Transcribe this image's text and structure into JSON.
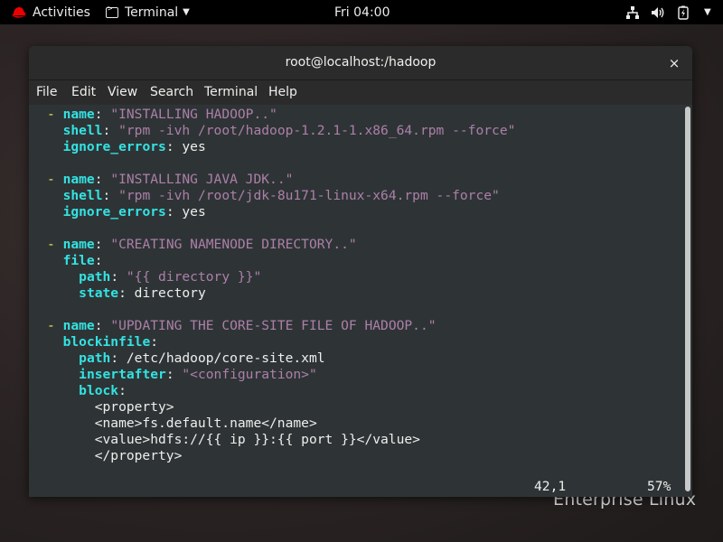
{
  "topbar": {
    "activities": "Activities",
    "app_name": "Terminal",
    "clock": "Fri 04:00"
  },
  "desktop": {
    "brand": "Enterprise Linux"
  },
  "window": {
    "title": "root@localhost:/hadoop",
    "close": "×"
  },
  "menu": [
    "File",
    "Edit",
    "View",
    "Search",
    "Terminal",
    "Help"
  ],
  "editor": {
    "lines": [
      [
        {
          "c": "d",
          "t": "- "
        },
        {
          "c": "k",
          "t": "name"
        },
        {
          "c": "",
          "t": ": "
        },
        {
          "c": "s",
          "t": "\"INSTALLING HADOOP..\""
        }
      ],
      [
        {
          "c": "",
          "t": "  "
        },
        {
          "c": "k",
          "t": "shell"
        },
        {
          "c": "",
          "t": ": "
        },
        {
          "c": "s",
          "t": "\"rpm -ivh /root/hadoop-1.2.1-1.x86_64.rpm --force\""
        }
      ],
      [
        {
          "c": "",
          "t": "  "
        },
        {
          "c": "k",
          "t": "ignore_errors"
        },
        {
          "c": "",
          "t": ": yes"
        }
      ],
      [],
      [
        {
          "c": "d",
          "t": "- "
        },
        {
          "c": "k",
          "t": "name"
        },
        {
          "c": "",
          "t": ": "
        },
        {
          "c": "s",
          "t": "\"INSTALLING JAVA JDK..\""
        }
      ],
      [
        {
          "c": "",
          "t": "  "
        },
        {
          "c": "k",
          "t": "shell"
        },
        {
          "c": "",
          "t": ": "
        },
        {
          "c": "s",
          "t": "\"rpm -ivh /root/jdk-8u171-linux-x64.rpm --force\""
        }
      ],
      [
        {
          "c": "",
          "t": "  "
        },
        {
          "c": "k",
          "t": "ignore_errors"
        },
        {
          "c": "",
          "t": ": yes"
        }
      ],
      [],
      [
        {
          "c": "d",
          "t": "- "
        },
        {
          "c": "k",
          "t": "name"
        },
        {
          "c": "",
          "t": ": "
        },
        {
          "c": "s",
          "t": "\"CREATING NAMENODE DIRECTORY..\""
        }
      ],
      [
        {
          "c": "",
          "t": "  "
        },
        {
          "c": "k",
          "t": "file"
        },
        {
          "c": "",
          "t": ":"
        }
      ],
      [
        {
          "c": "",
          "t": "    "
        },
        {
          "c": "k",
          "t": "path"
        },
        {
          "c": "",
          "t": ": "
        },
        {
          "c": "s",
          "t": "\"{{ directory }}\""
        }
      ],
      [
        {
          "c": "",
          "t": "    "
        },
        {
          "c": "k",
          "t": "state"
        },
        {
          "c": "",
          "t": ": directory"
        }
      ],
      [],
      [
        {
          "c": "d",
          "t": "- "
        },
        {
          "c": "k",
          "t": "name"
        },
        {
          "c": "",
          "t": ": "
        },
        {
          "c": "s",
          "t": "\"UPDATING THE CORE-SITE FILE OF HADOOP..\""
        }
      ],
      [
        {
          "c": "",
          "t": "  "
        },
        {
          "c": "k",
          "t": "blockinfile"
        },
        {
          "c": "",
          "t": ":"
        }
      ],
      [
        {
          "c": "",
          "t": "    "
        },
        {
          "c": "k",
          "t": "path"
        },
        {
          "c": "",
          "t": ": /etc/hadoop/core-site.xml"
        }
      ],
      [
        {
          "c": "",
          "t": "    "
        },
        {
          "c": "k",
          "t": "insertafter"
        },
        {
          "c": "",
          "t": ": "
        },
        {
          "c": "s",
          "t": "\"<configuration>\""
        }
      ],
      [
        {
          "c": "",
          "t": "    "
        },
        {
          "c": "k",
          "t": "block"
        },
        {
          "c": "",
          "t": ":"
        }
      ],
      [
        {
          "c": "",
          "t": "      <property>"
        }
      ],
      [
        {
          "c": "",
          "t": "      <name>fs.default.name</name>"
        }
      ],
      [
        {
          "c": "",
          "t": "      <value>hdfs://{{ ip }}:{{ port }}</value>"
        }
      ],
      [
        {
          "c": "",
          "t": "      </property>"
        }
      ]
    ],
    "cursor_pos": "42,1",
    "scroll_percent": "57%"
  },
  "colors": {
    "key": "#34e2e2",
    "string": "#ad7fa8",
    "dash": "#fce94f",
    "background": "#2e3436"
  }
}
